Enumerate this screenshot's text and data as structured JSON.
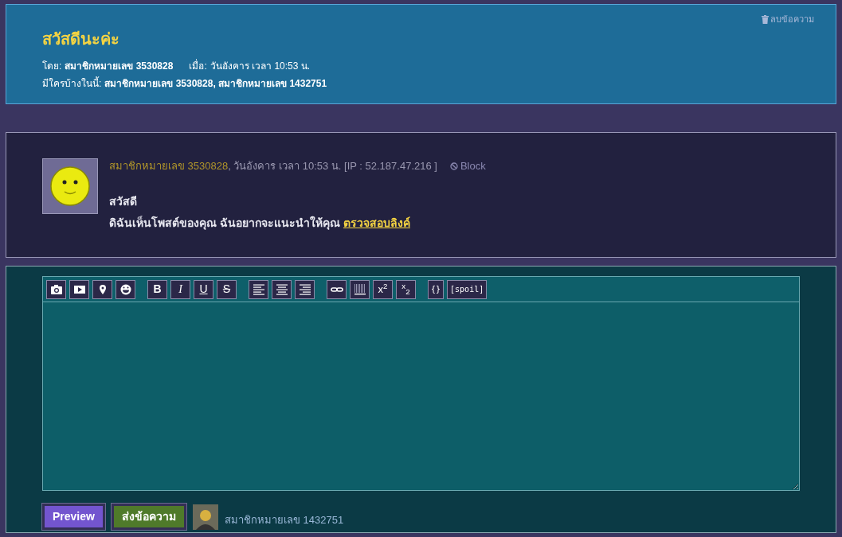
{
  "topic": {
    "title": "สวัสดีนะค่ะ",
    "delete_link": "ลบข้อความ",
    "by_label": "โดย:",
    "by_value": "สมาชิกหมายเลข 3530828",
    "when_label": "เมื่อ:",
    "when_value": "วันอังคาร เวลา 10:53 น.",
    "present_label": "มีใครบ้างในนี้:",
    "present_value": "สมาชิกหมายเลข 3530828, สมาชิกหมายเลข 1432751"
  },
  "post": {
    "author": "สมาชิกหมายเลข 3530828",
    "meta": ", วันอังคาร เวลา 10:53 น. [IP : 52.187.47.216 ]",
    "block": "Block",
    "lines": [
      "สวัสดี"
    ],
    "body": "ดิฉันเห็นโพสต์ของคุณ ฉันอยากจะแนะนำให้คุณ",
    "link": "ตรวจสอบลิงค์"
  },
  "toolbar": [
    {
      "kind": "media"
    },
    {
      "kind": "format",
      "buttons": [
        "B",
        "I",
        "U",
        "S"
      ]
    },
    {
      "kind": "align"
    },
    {
      "kind": "insert",
      "scripts": [
        {
          "kind": "sup",
          "base": "x",
          "index": "2"
        },
        {
          "kind": "sub",
          "base": "x",
          "index": "2"
        }
      ]
    },
    {
      "kind": "code",
      "buttons": [
        "{}",
        "[spoil]"
      ]
    }
  ],
  "reply": {
    "preview": "Preview",
    "send": "ส่งข้อความ",
    "user": "สมาชิกหมายเลข 1432751"
  }
}
